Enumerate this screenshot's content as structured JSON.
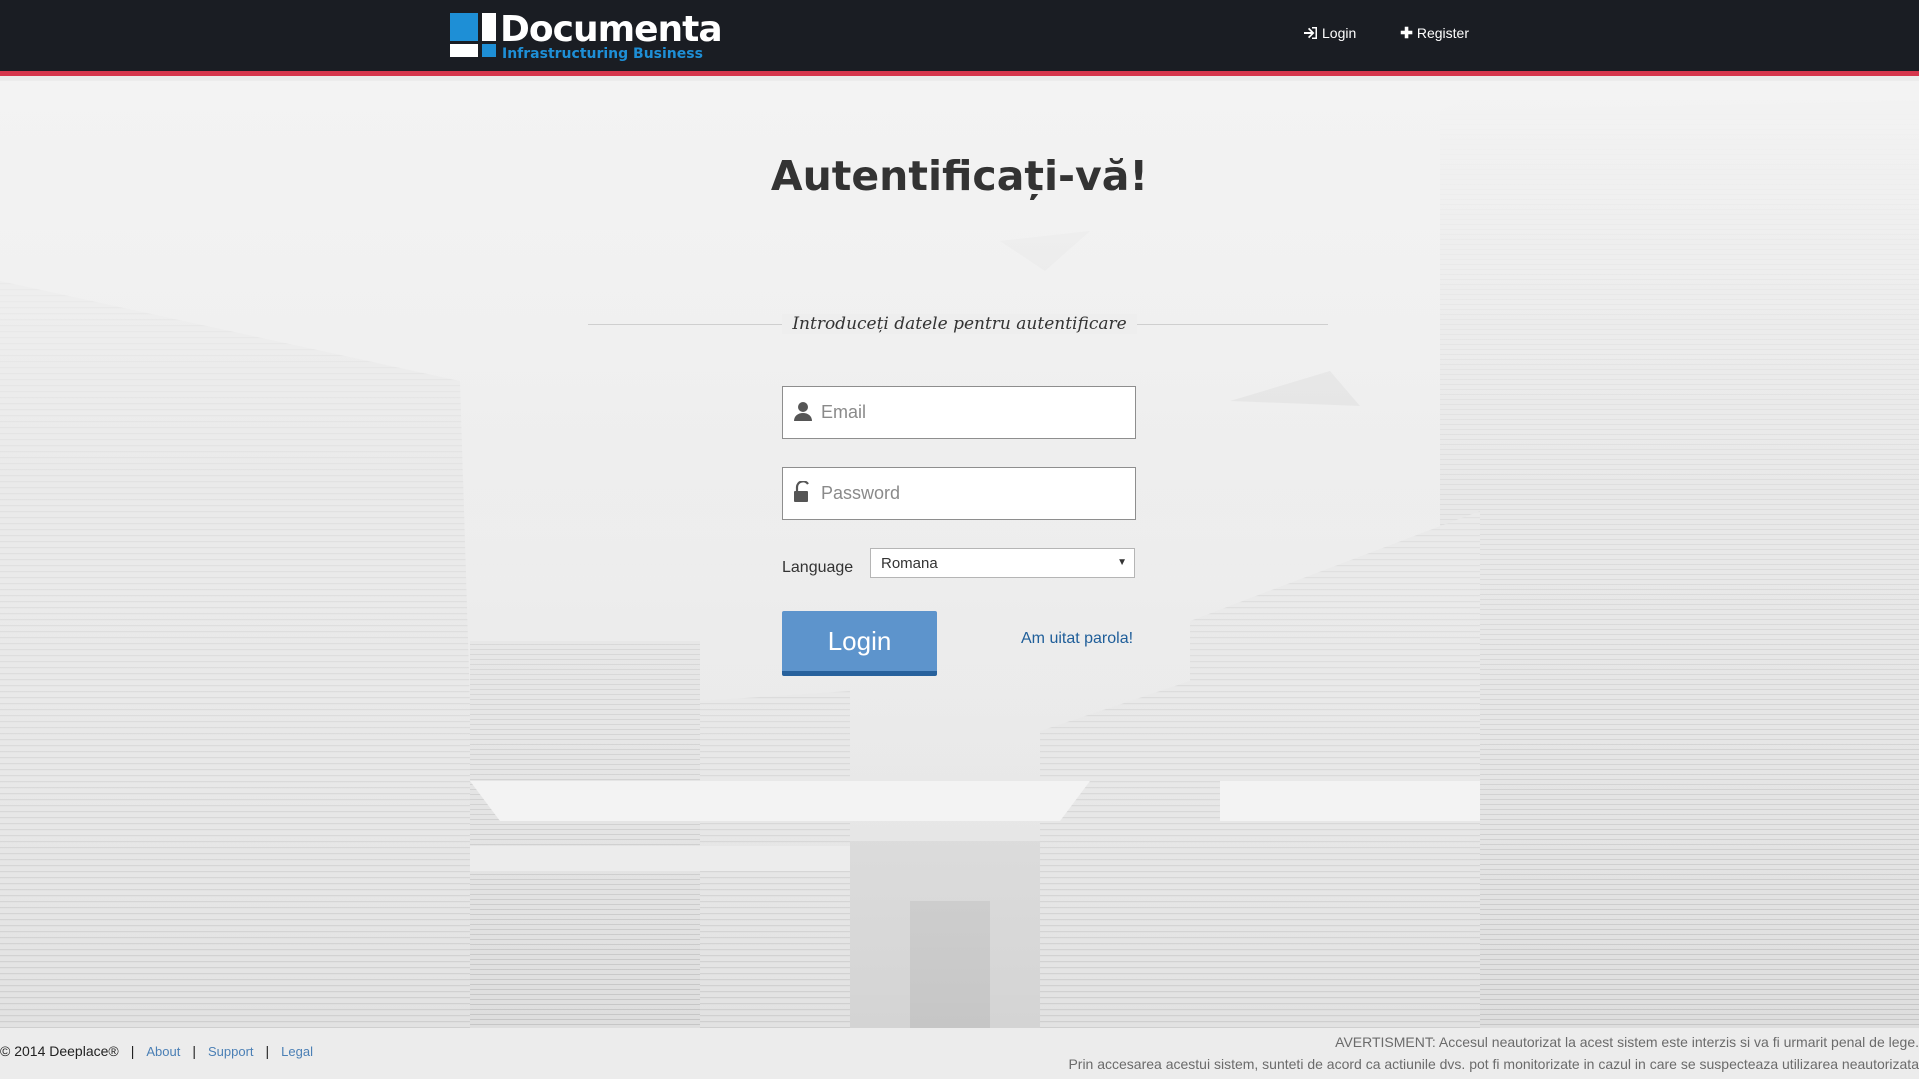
{
  "navbar": {
    "logo": {
      "word": "Documenta",
      "tagline": "Infrastructuring Business"
    },
    "links": {
      "login": "Login",
      "register": "Register"
    },
    "colors": {
      "background": "#1a1d23",
      "accent_border": "#d6374d",
      "brand_blue": "#1e8fd6"
    }
  },
  "login": {
    "title": "Autentificați-vă!",
    "subtitle": "Introduceți datele pentru autentificare",
    "email_placeholder": "Email",
    "password_placeholder": "Password",
    "language_label": "Language",
    "language_selected": "Romana",
    "login_button": "Login",
    "forgot_link": "Am uitat parola!"
  },
  "footer": {
    "copyright": "© 2014 Deeplace®",
    "links": {
      "about": "About",
      "support": "Support",
      "legal": "Legal"
    },
    "separator": "|",
    "warning_line1": "AVERTISMENT: Accesul neautorizat la acest sistem este interzis si va fi urmarit penal de lege.",
    "warning_line2": "Prin accesarea acestui sistem, sunteti de acord ca actiunile dvs. pot fi monitorizate in cazul in care se suspecteaza utilizarea neautorizata"
  },
  "icons": {
    "login": "sign-in-icon",
    "register": "plus-icon",
    "email": "user-icon",
    "password": "lock-icon",
    "select": "caret-down-icon"
  }
}
